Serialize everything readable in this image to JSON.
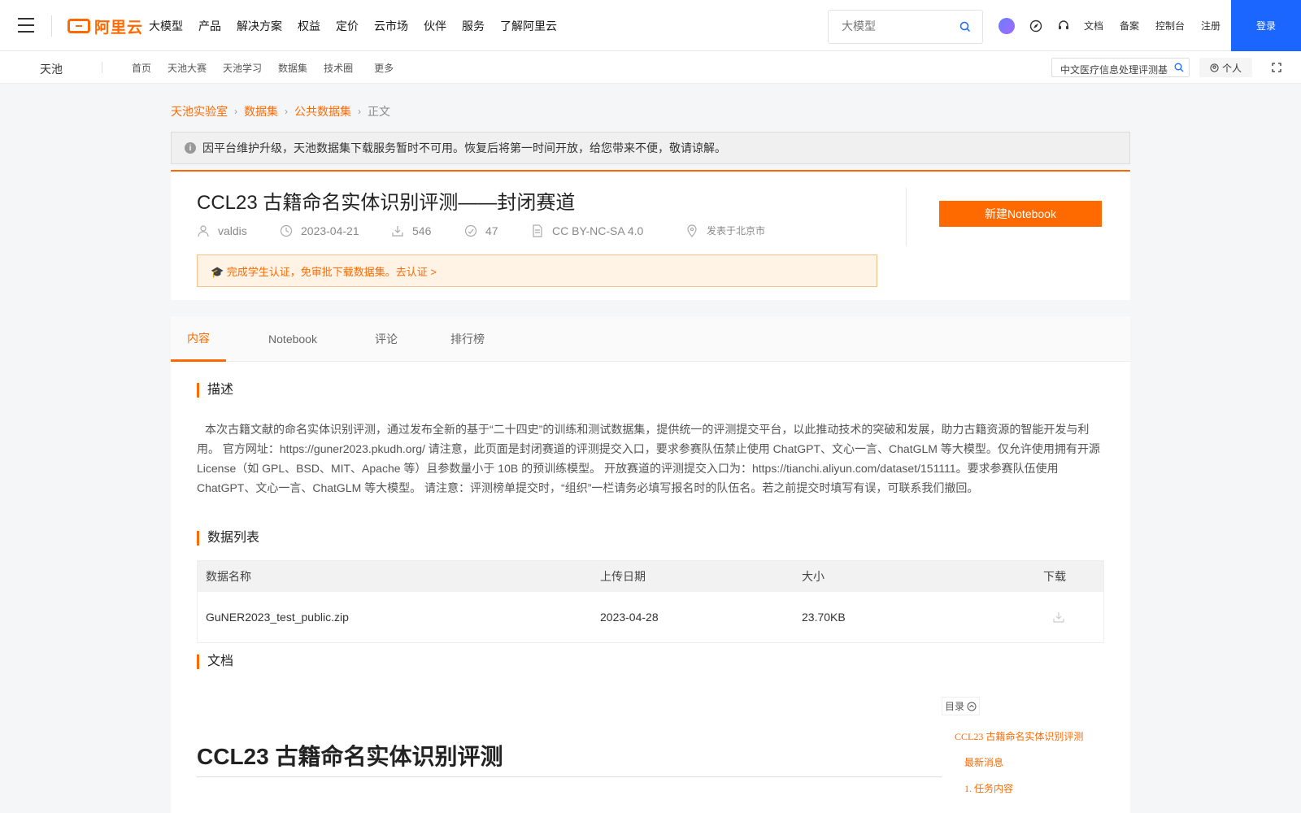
{
  "topnav": {
    "menu": [
      "大模型",
      "产品",
      "解决方案",
      "权益",
      "定价",
      "云市场",
      "伙伴",
      "服务",
      "了解阿里云"
    ],
    "logo_text": "阿里云",
    "search_placeholder": "大模型",
    "links": [
      "文档",
      "备案",
      "控制台",
      "注册"
    ],
    "login": "登录"
  },
  "subnav": {
    "brand": "天池",
    "items": [
      "首页",
      "天池大赛",
      "天池学习",
      "数据集",
      "技术圈"
    ],
    "more": "更多",
    "search_text": "中文医疗信息处理评测基",
    "personal": "个人"
  },
  "breadcrumb": [
    "天池实验室",
    "数据集",
    "公共数据集",
    "正文"
  ],
  "notice": "因平台维护升级，天池数据集下载服务暂时不可用。恢复后将第一时间开放，给您带来不便，敬请谅解。",
  "dataset": {
    "title": "CCL23 古籍命名实体识别评测——封闭赛道",
    "author": "valdis",
    "date": "2023-04-21",
    "downloads": "546",
    "likes": "47",
    "license": "CC BY-NC-SA 4.0",
    "location": "发表于北京市",
    "cert_text": "🎓 完成学生认证，免审批下载数据集。去认证 >",
    "notebook_btn": "新建Notebook"
  },
  "tabs": [
    "内容",
    "Notebook",
    "评论",
    "排行榜"
  ],
  "sections": {
    "description_title": "描述",
    "description": "本次古籍文献的命名实体识别评测，通过发布全新的基于“二十四史”的训练和测试数据集，提供统一的评测提交平台，以此推动技术的突破和发展，助力古籍资源的智能开发与利用。 官方网址：https://guner2023.pkudh.org/ 请注意，此页面是封闭赛道的评测提交入口，要求参赛队伍禁止使用 ChatGPT、文心一言、ChatGLM 等大模型。仅允许使用拥有开源 License（如 GPL、BSD、MIT、Apache 等）且参数量小于 10B 的预训练模型。 开放赛道的评测提交入口为：https://tianchi.aliyun.com/dataset/151111。要求参赛队伍使用 ChatGPT、文心一言、ChatGLM 等大模型。 请注意：评测榜单提交时，“组织”一栏请务必填写报名时的队伍名。若之前提交时填写有误，可联系我们撤回。",
    "datalist_title": "数据列表",
    "table_headers": [
      "数据名称",
      "上传日期",
      "大小",
      "下载"
    ],
    "table_rows": [
      {
        "name": "GuNER2023_test_public.zip",
        "date": "2023-04-28",
        "size": "23.70KB"
      }
    ],
    "doc_title": "文档",
    "doc_heading": "CCL23 古籍命名实体识别评测"
  },
  "toc": {
    "label": "目录",
    "items": [
      "CCL23 古籍命名实体识别评测",
      "最新消息",
      "1. 任务内容"
    ]
  },
  "colors": {
    "accent": "#ff6a00",
    "login_blue": "#1b66ff"
  }
}
